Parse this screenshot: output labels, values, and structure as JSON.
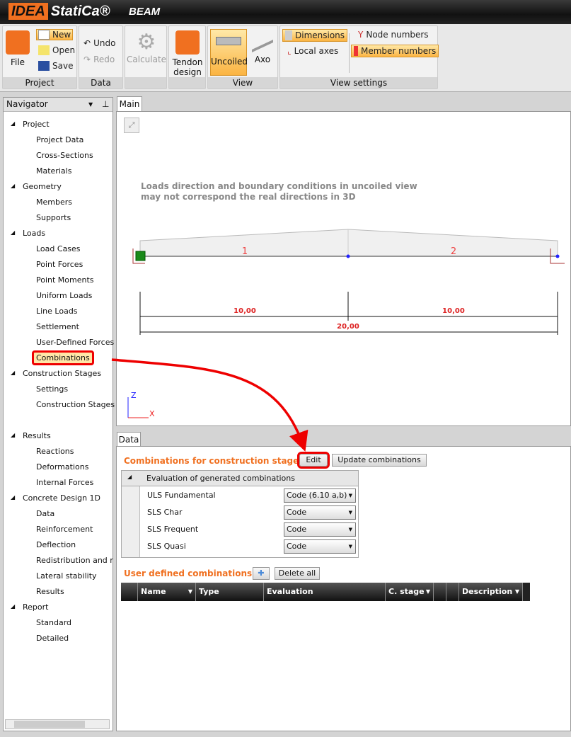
{
  "app": {
    "logo": "IDEA StatiCa",
    "product": "BEAM"
  },
  "ribbon": {
    "project": {
      "label": "Project",
      "file": "File",
      "new": "New",
      "open": "Open",
      "save": "Save"
    },
    "data": {
      "label": "Data",
      "undo": "Undo",
      "redo": "Redo"
    },
    "calculate": "Calculate",
    "tendon": "Tendon design",
    "view": {
      "label": "View",
      "uncoiled": "Uncoiled",
      "axo": "Axo"
    },
    "view_settings": {
      "label": "View settings",
      "dimensions": "Dimensions",
      "local_axes": "Local axes",
      "node_numbers": "Node numbers",
      "member_numbers": "Member numbers"
    }
  },
  "navigator": {
    "title": "Navigator",
    "items": [
      {
        "label": "Project",
        "level": 0
      },
      {
        "label": "Project Data",
        "level": 1
      },
      {
        "label": "Cross-Sections",
        "level": 1
      },
      {
        "label": "Materials",
        "level": 1
      },
      {
        "label": "Geometry",
        "level": 0
      },
      {
        "label": "Members",
        "level": 1
      },
      {
        "label": "Supports",
        "level": 1
      },
      {
        "label": "Loads",
        "level": 0
      },
      {
        "label": "Load Cases",
        "level": 1
      },
      {
        "label": "Point Forces",
        "level": 1
      },
      {
        "label": "Point Moments",
        "level": 1
      },
      {
        "label": "Uniform Loads",
        "level": 1
      },
      {
        "label": "Line Loads",
        "level": 1
      },
      {
        "label": "Settlement",
        "level": 1
      },
      {
        "label": "User-Defined Forces",
        "level": 1
      },
      {
        "label": "Combinations",
        "level": 1,
        "selected": true
      },
      {
        "label": "Construction Stages",
        "level": 0
      },
      {
        "label": "Settings",
        "level": 1
      },
      {
        "label": "Construction Stages",
        "level": 1
      },
      {
        "label": "Results",
        "level": 0,
        "gap": true
      },
      {
        "label": "Reactions",
        "level": 1
      },
      {
        "label": "Deformations",
        "level": 1
      },
      {
        "label": "Internal Forces",
        "level": 1
      },
      {
        "label": "Concrete Design 1D",
        "level": 0
      },
      {
        "label": "Data",
        "level": 1
      },
      {
        "label": "Reinforcement",
        "level": 1
      },
      {
        "label": "Deflection",
        "level": 1
      },
      {
        "label": "Redistribution and r",
        "level": 1
      },
      {
        "label": "Lateral stability",
        "level": 1
      },
      {
        "label": "Results",
        "level": 1
      },
      {
        "label": "Report",
        "level": 0
      },
      {
        "label": "Standard",
        "level": 1
      },
      {
        "label": "Detailed",
        "level": 1
      }
    ]
  },
  "main": {
    "tab": "Main",
    "note": [
      "Loads direction and boundary conditions in uncoiled view",
      "may not correspond the real directions in 3D"
    ],
    "members": [
      "1",
      "2"
    ],
    "dims": [
      "10,00",
      "10,00",
      "20,00"
    ],
    "axes": {
      "z": "Z",
      "x": "X"
    }
  },
  "data_panel": {
    "tab": "Data",
    "title": "Combinations for construction stages",
    "edit": "Edit",
    "update": "Update combinations",
    "group": "Evaluation of generated combinations",
    "rows": [
      {
        "label": "ULS Fundamental",
        "value": "Code (6.10 a,b)"
      },
      {
        "label": "SLS Char",
        "value": "Code"
      },
      {
        "label": "SLS Frequent",
        "value": "Code"
      },
      {
        "label": "SLS Quasi",
        "value": "Code"
      }
    ],
    "user_title": "User defined combinations",
    "delete_all": "Delete all",
    "columns": [
      "Name",
      "Type",
      "Evaluation",
      "C. stage",
      "",
      "",
      "Description"
    ]
  },
  "colors": {
    "accent": "#f07020",
    "highlight": "#e00000"
  }
}
